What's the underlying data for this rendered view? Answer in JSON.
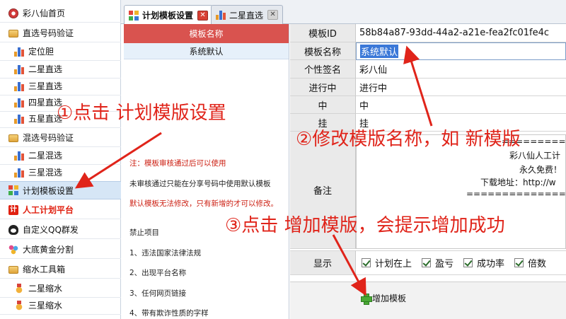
{
  "sidebar": {
    "items": [
      {
        "label": "彩八仙首页",
        "icon": "home-icon"
      },
      {
        "label": "直选号码验证",
        "icon": "folder-icon"
      },
      {
        "label": "定位胆",
        "icon": "bar-chart-icon"
      },
      {
        "label": "二星直选",
        "icon": "bar-chart-icon"
      },
      {
        "label": "三星直选",
        "icon": "bar-chart-icon"
      },
      {
        "label": "四星直选",
        "icon": "bar-chart-icon"
      },
      {
        "label": "五星直选",
        "icon": "bar-chart-icon"
      },
      {
        "label": "混选号码验证",
        "icon": "folder-icon"
      },
      {
        "label": "二星混选",
        "icon": "bar-chart-icon"
      },
      {
        "label": "三星混选",
        "icon": "bar-chart-icon"
      },
      {
        "label": "计划模板设置",
        "icon": "grid-icon"
      },
      {
        "label": "人工计划平台",
        "icon": "plan-icon"
      },
      {
        "label": "自定义QQ群发",
        "icon": "qq-icon"
      },
      {
        "label": "大底黄金分割",
        "icon": "gold-icon"
      },
      {
        "label": "缩水工具箱",
        "icon": "folder-icon"
      },
      {
        "label": "二星缩水",
        "icon": "medal-icon"
      },
      {
        "label": "三星缩水",
        "icon": "medal-icon"
      }
    ]
  },
  "tabs": [
    {
      "label": "计划模板设置",
      "close": "✕"
    },
    {
      "label": "二星直选",
      "close": "✕"
    }
  ],
  "plan_icon_glyph": "计",
  "template_list": {
    "header": "模板名称",
    "rows": [
      "系统默认"
    ],
    "notes": [
      "注：模板审核通过后可以使用",
      "未审核通过只能在分享号码中使用默认模板",
      "默认模板无法修改，只有新增的才可以修改。",
      "禁止项目",
      "1、违法国家法律法规",
      "2、出现平台名称",
      "3、任何网页链接",
      "4、带有欺诈性质的字样"
    ]
  },
  "form": {
    "template_id": {
      "label": "模板ID",
      "value": "58b84a87-93dd-44a2-a21e-fea2fc01fe4c"
    },
    "template_name": {
      "label": "模板名称",
      "value": "系统默认"
    },
    "signature": {
      "label": "个性签名",
      "value": "彩八仙"
    },
    "in_progress": {
      "label": "进行中",
      "value": "进行中"
    },
    "hit": {
      "label": "中",
      "value": "中"
    },
    "miss": {
      "label": "挂",
      "value": "挂"
    },
    "remark": {
      "label": "备注",
      "lines": [
        "============",
        "彩八仙人工计",
        "永久免费！",
        "下载地址：http://w",
        "================="
      ]
    },
    "display": {
      "label": "显示",
      "options": [
        {
          "label": "计划在上",
          "checked": true
        },
        {
          "label": "盈亏",
          "checked": true
        },
        {
          "label": "成功率",
          "checked": true
        },
        {
          "label": "倍数",
          "checked": true
        }
      ]
    },
    "add_button": "增加模板"
  },
  "annotations": {
    "step1": "①点击 计划模版设置",
    "step2": "②修改模版名称，如 新模版",
    "step3": "③点击 增加模版，会提示增加成功"
  },
  "colors": {
    "accent_red": "#e0241a",
    "header_red": "#d9534f",
    "selection_blue": "#3a78d8"
  }
}
